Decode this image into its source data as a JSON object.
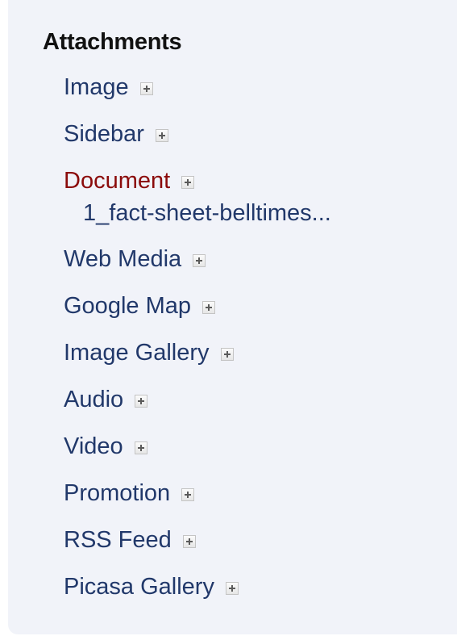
{
  "attachments": {
    "title": "Attachments",
    "items": [
      {
        "label": "Image"
      },
      {
        "label": "Sidebar"
      },
      {
        "label": "Document",
        "files": [
          "1_fact-sheet-belltimes..."
        ]
      },
      {
        "label": "Web Media"
      },
      {
        "label": "Google Map"
      },
      {
        "label": "Image Gallery"
      },
      {
        "label": "Audio"
      },
      {
        "label": "Video"
      },
      {
        "label": "Promotion"
      },
      {
        "label": "RSS Feed"
      },
      {
        "label": "Picasa Gallery"
      }
    ]
  },
  "colors": {
    "panel_background": "#f1f3f9",
    "link": "#21386a",
    "active_link": "#8b0b0b",
    "title": "#111111"
  },
  "icons": {
    "add": "plus-box-icon"
  }
}
